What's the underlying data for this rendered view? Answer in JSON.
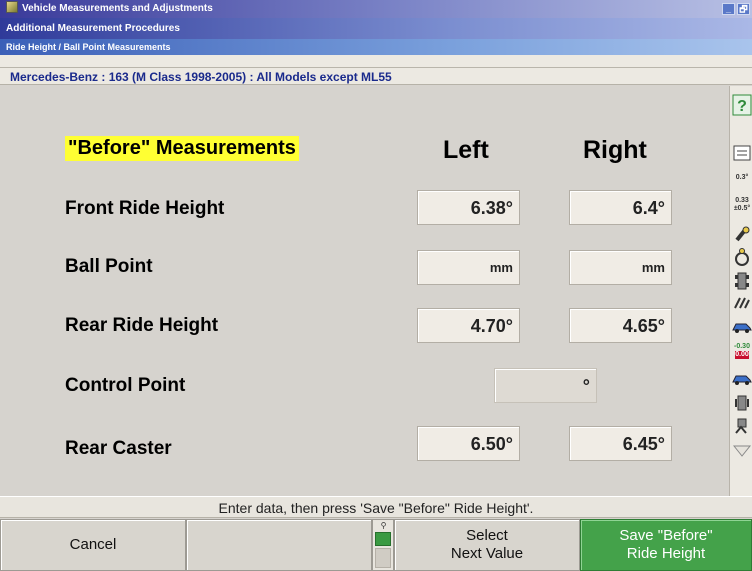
{
  "window": {
    "title": "Vehicle Measurements and Adjustments",
    "breadcrumb_1": "Additional Measurement Procedures",
    "breadcrumb_2": "Ride Height / Ball Point Measurements",
    "min_glyph": "_",
    "restore_glyph": "🗗"
  },
  "vehicle": "Mercedes-Benz : 163 (M Class 1998-2005) : All Models except ML55",
  "headers": {
    "section": "\"Before\" Measurements",
    "left": "Left",
    "right": "Right"
  },
  "rows": [
    {
      "label": "Front Ride Height",
      "left": "6.38°",
      "right": "6.4°"
    },
    {
      "label": "Ball Point",
      "left": "mm",
      "right": "mm"
    },
    {
      "label": "Rear Ride Height",
      "left": "4.70°",
      "right": "4.65°"
    },
    {
      "label": "Control Point",
      "center": "°"
    },
    {
      "label": "Rear Caster",
      "left": "6.50°",
      "right": "6.45°"
    }
  ],
  "toolbar": {
    "items": [
      "help-icon",
      "print-icon",
      "spec-values-icon",
      "tolerance-icon",
      "wrench-icon",
      "steering-wheel-icon",
      "vehicle-top-icon",
      "tread-icon",
      "car-side-icon",
      "angle-readout-icon",
      "car-front-icon",
      "alignment-icon",
      "sensor-icon",
      "expand-icon"
    ],
    "label_0_3": "0.3°",
    "label_0_33": "0.33",
    "label_0_5": "±0.5°",
    "readout_top": "-0.30",
    "readout_bottom": "0.00",
    "colors": {
      "help": "#2f8a3a",
      "readout_bg": "#c8102e",
      "readout_fg": "#ffffff"
    }
  },
  "instruction": "Enter data, then press 'Save \"Before\" Ride Height'.",
  "buttons": {
    "cancel": "Cancel",
    "blank": "",
    "select": "Select\nNext Value",
    "save": "Save \"Before\"\nRide Height"
  },
  "colors": {
    "save_button": "#44a24a",
    "highlight": "#ffff33",
    "title_text": "#1a2a8c"
  }
}
